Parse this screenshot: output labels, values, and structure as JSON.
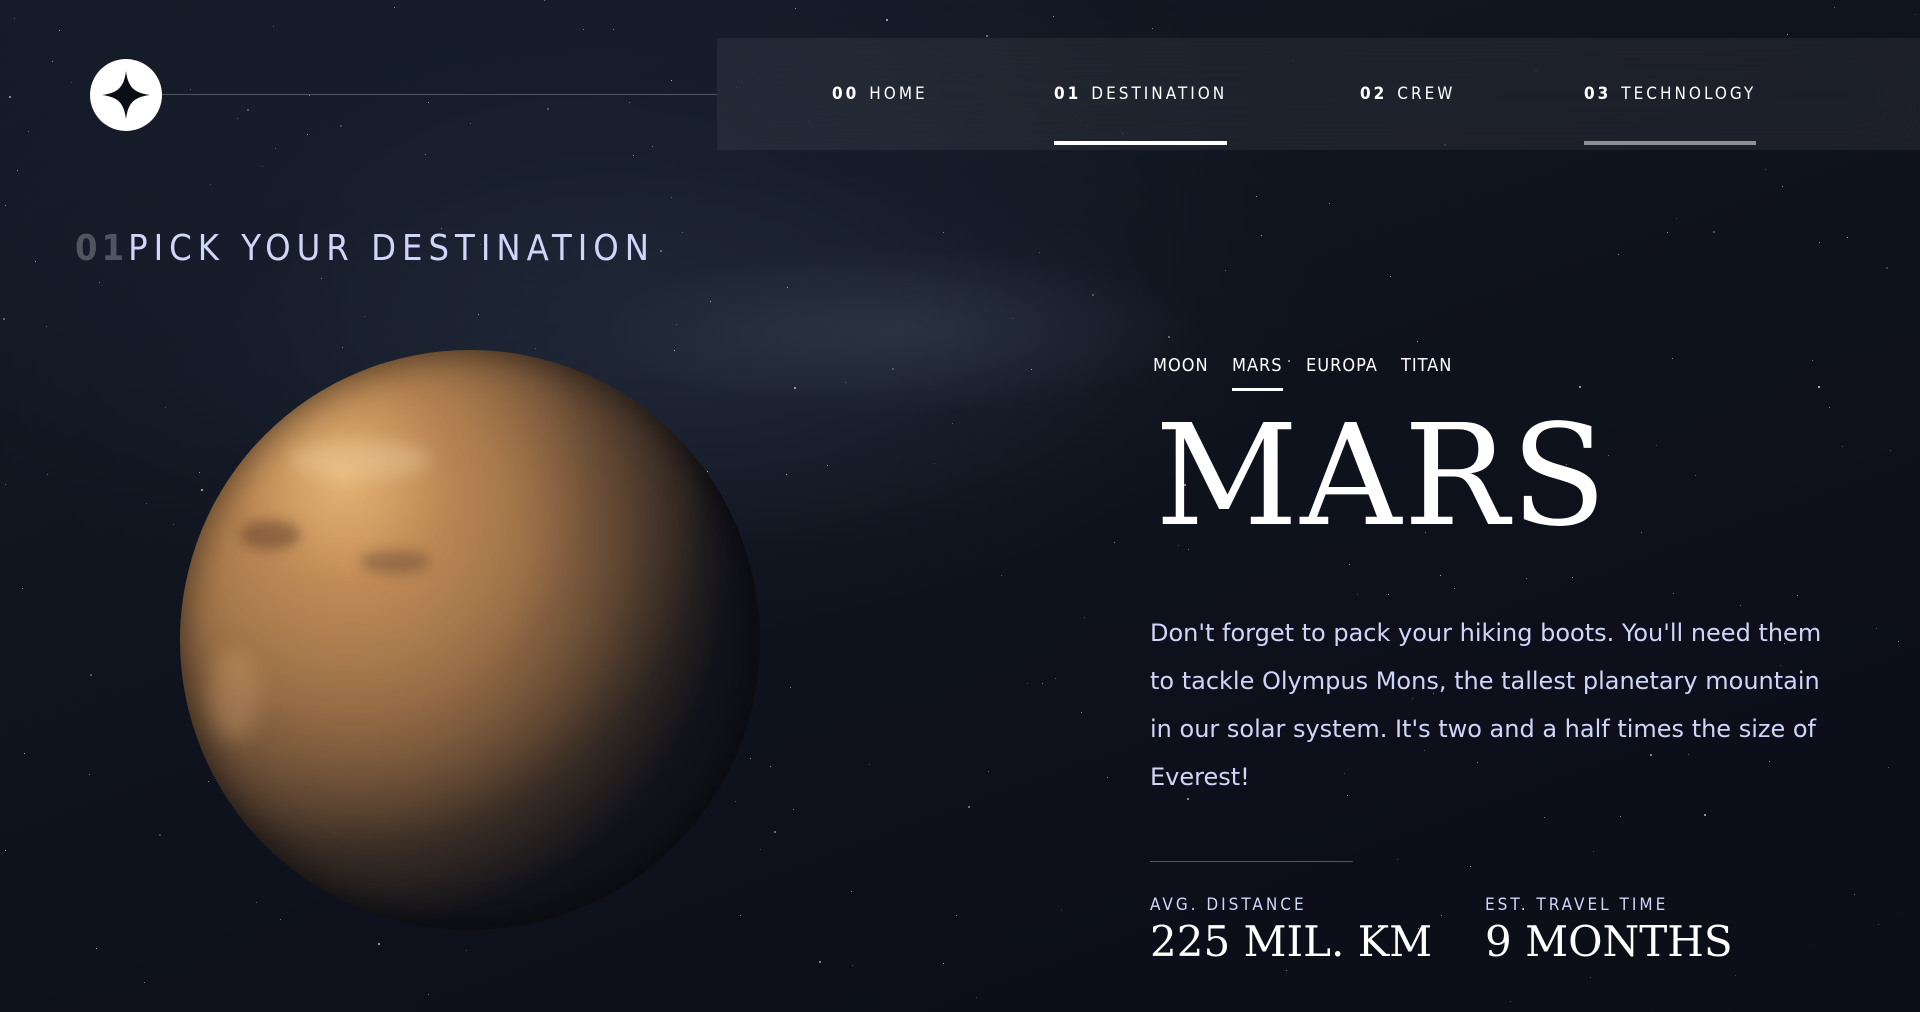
{
  "nav": {
    "items": [
      {
        "number": "00",
        "label": "HOME"
      },
      {
        "number": "01",
        "label": "DESTINATION"
      },
      {
        "number": "02",
        "label": "CREW"
      },
      {
        "number": "03",
        "label": "TECHNOLOGY"
      }
    ],
    "active_index": 1
  },
  "page": {
    "heading_number": "01",
    "heading_text": "PICK YOUR DESTINATION"
  },
  "destination": {
    "tabs": [
      "MOON",
      "MARS",
      "EUROPA",
      "TITAN"
    ],
    "active_tab": "MARS",
    "name": "MARS",
    "description": "Don't forget to pack your hiking boots. You'll need them to tackle Olympus Mons, the tallest planetary mountain in our solar system. It's two and a half times the size of Everest!",
    "stats": [
      {
        "label": "AVG. DISTANCE",
        "value": "225 MIL. KM"
      },
      {
        "label": "EST. TRAVEL TIME",
        "value": "9 MONTHS"
      }
    ]
  },
  "icons": {
    "logo": "star-logo-icon",
    "planet": "mars-planet-image"
  },
  "colors": {
    "background": "#0b0d17",
    "text_primary": "#ffffff",
    "text_secondary": "#d0d6f9"
  }
}
